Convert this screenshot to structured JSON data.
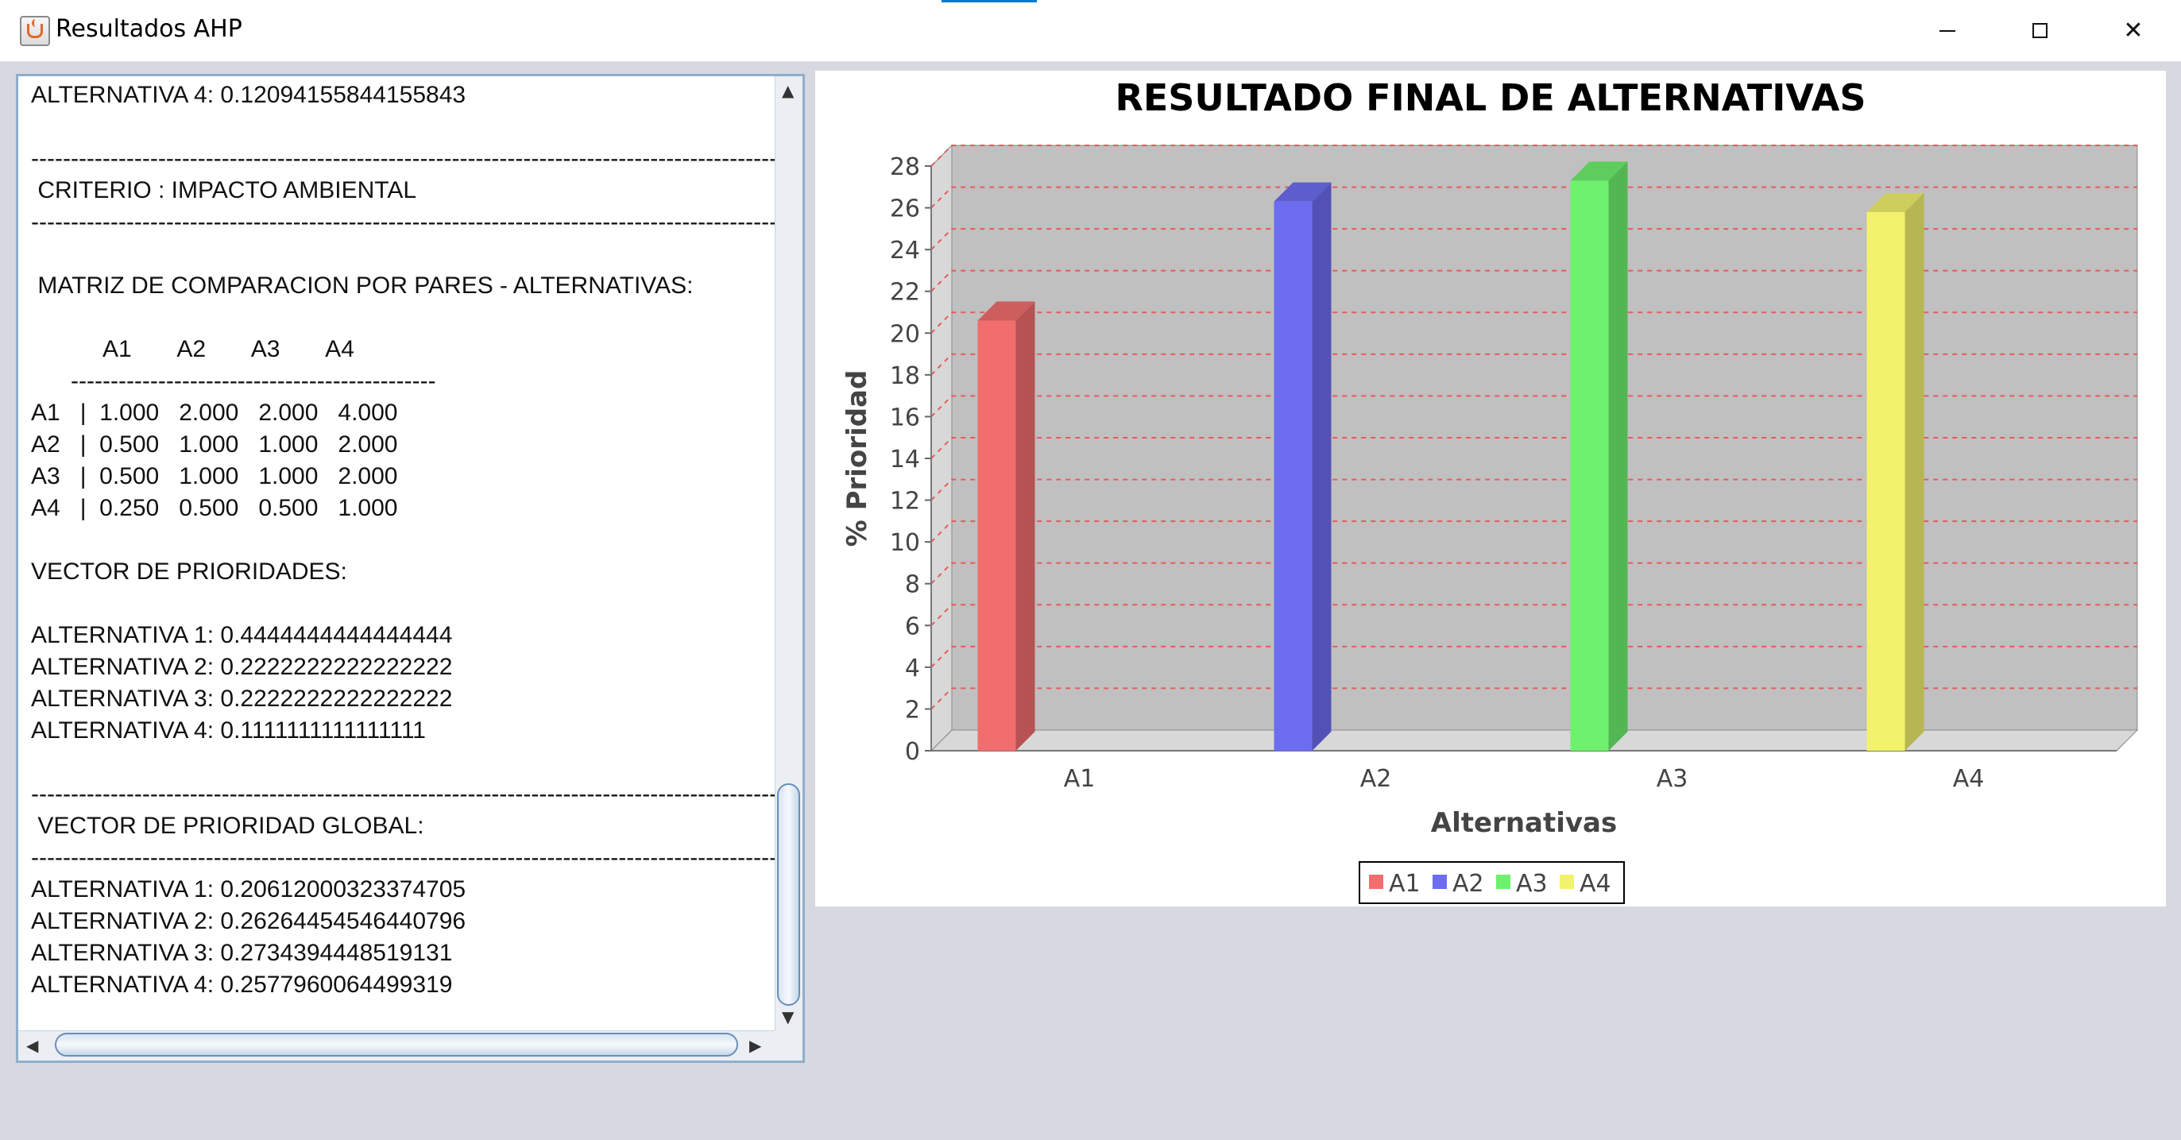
{
  "window": {
    "title": "Resultados AHP",
    "controls": {
      "minimize": "",
      "maximize": "",
      "close": "✕"
    }
  },
  "text_panel": {
    "lines": [
      "ALTERNATIVA 4: 0.12094155844155843",
      "",
      "---------------------------------------------------------------------------------------------------------------",
      " CRITERIO : IMPACTO AMBIENTAL",
      "---------------------------------------------------------------------------------------------------------------",
      "",
      " MATRIZ DE COMPARACION POR PARES - ALTERNATIVAS:",
      "",
      "           A1       A2       A3       A4",
      "      ----------------------------------------------",
      "A1   |  1.000   2.000   2.000   4.000",
      "A2   |  0.500   1.000   1.000   2.000",
      "A3   |  0.500   1.000   1.000   2.000",
      "A4   |  0.250   0.500   0.500   1.000",
      "",
      "VECTOR DE PRIORIDADES:",
      "",
      "ALTERNATIVA 1: 0.4444444444444444",
      "ALTERNATIVA 2: 0.2222222222222222",
      "ALTERNATIVA 3: 0.2222222222222222",
      "ALTERNATIVA 4: 0.1111111111111111",
      "",
      "---------------------------------------------------------------------------------------------------------------",
      " VECTOR DE PRIORIDAD GLOBAL:",
      "---------------------------------------------------------------------------------------------------------------",
      "ALTERNATIVA 1: 0.20612000323374705",
      "ALTERNATIVA 2: 0.26264454546440796",
      "ALTERNATIVA 3: 0.2734394448519131",
      "ALTERNATIVA 4: 0.2577960064499319"
    ]
  },
  "chart_data": {
    "type": "bar",
    "title": "RESULTADO FINAL DE ALTERNATIVAS",
    "xlabel": "Alternativas",
    "ylabel": "% Prioridad",
    "categories": [
      "A1",
      "A2",
      "A3",
      "A4"
    ],
    "series": [
      {
        "name": "A1",
        "color": "#f26d6d",
        "values": [
          20.6,
          null,
          null,
          null
        ]
      },
      {
        "name": "A2",
        "color": "#6d6df2",
        "values": [
          null,
          26.3,
          null,
          null
        ]
      },
      {
        "name": "A3",
        "color": "#6df26d",
        "values": [
          null,
          null,
          27.3,
          null
        ]
      },
      {
        "name": "A4",
        "color": "#f2f26d",
        "values": [
          null,
          null,
          null,
          25.8
        ]
      }
    ],
    "ylim": [
      0,
      28
    ],
    "yticks": [
      0,
      2,
      4,
      6,
      8,
      10,
      12,
      14,
      16,
      18,
      20,
      22,
      24,
      26,
      28
    ],
    "grid": true,
    "grid_color": "#e85a5a",
    "plot_background": "#c0c0c0",
    "legend": "bottom-center"
  }
}
